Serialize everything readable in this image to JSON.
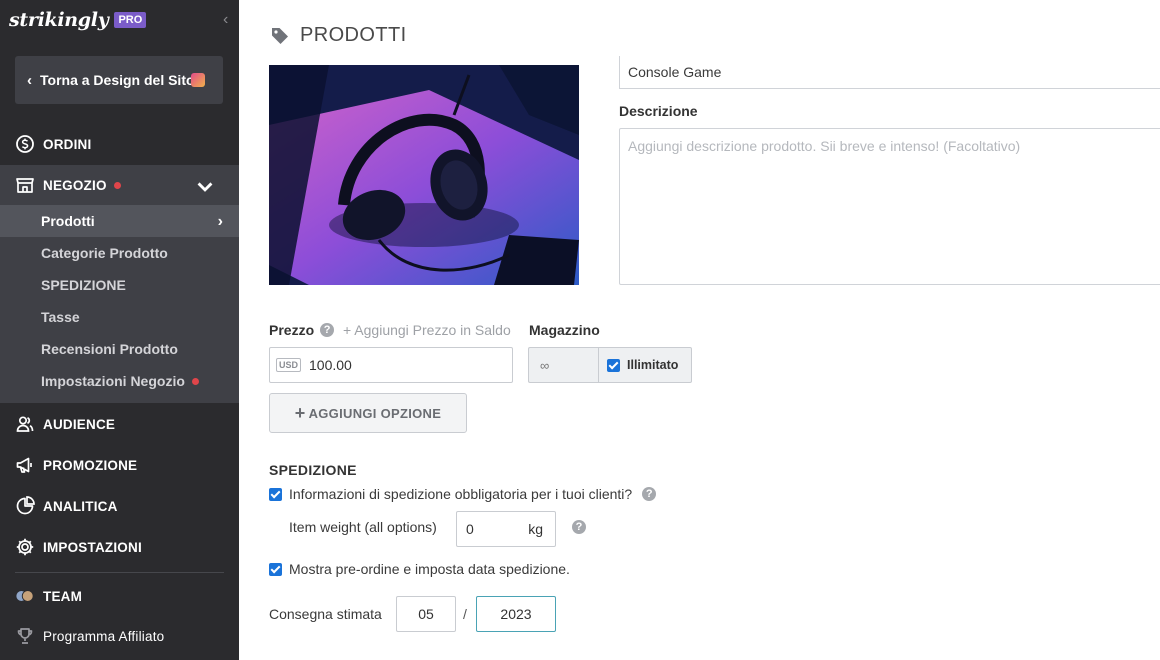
{
  "brand": {
    "logo": "strikingly",
    "badge": "PRO"
  },
  "sidebar": {
    "back_label": "Torna a Design del Sito",
    "items": [
      {
        "label": "ORDINI",
        "icon": "dollar-circle-icon"
      },
      {
        "label": "NEGOZIO",
        "icon": "store-icon"
      },
      {
        "label": "AUDIENCE",
        "icon": "users-icon"
      },
      {
        "label": "PROMOZIONE",
        "icon": "megaphone-icon"
      },
      {
        "label": "ANALITICA",
        "icon": "pie-chart-icon"
      },
      {
        "label": "IMPOSTAZIONI",
        "icon": "gear-icon"
      },
      {
        "label": "TEAM",
        "icon": "team-avatars-icon"
      },
      {
        "label": "Programma Affiliato",
        "icon": "trophy-icon"
      }
    ],
    "shop_sub": [
      "Prodotti",
      "Categorie Prodotto",
      "SPEDIZIONE",
      "Tasse",
      "Recensioni Prodotto",
      "Impostazioni Negozio"
    ]
  },
  "page": {
    "title": "PRODOTTI"
  },
  "product": {
    "name": "Console Game",
    "description_label": "Descrizione",
    "description_placeholder": "Aggiungi descrizione prodotto. Sii breve e intenso! (Facoltativo)",
    "price_label": "Prezzo",
    "sale_link": "+ Aggiungi Prezzo in Saldo",
    "currency": "USD",
    "price": "100.00",
    "stock_label": "Magazzino",
    "stock_value": "∞",
    "unlimited_label": "Illimitato",
    "add_option": "AGGIUNGI OPZIONE"
  },
  "shipping": {
    "title": "SPEDIZIONE",
    "required_info": "Informazioni di spedizione obbligatoria per i tuoi clienti?",
    "weight_label": "Item weight (all options)",
    "weight_value": "0",
    "weight_unit": "kg",
    "preorder": "Mostra pre-ordine e imposta data spedizione.",
    "eta_label": "Consegna stimata",
    "eta_month": "05",
    "eta_sep": "/",
    "eta_year": "2023"
  },
  "colors": {
    "sidebar_bg": "#2b2b2e",
    "accent_purple": "#7b5cc9",
    "checkbox_blue": "#1a73d9",
    "red_dot": "#e0454a"
  }
}
